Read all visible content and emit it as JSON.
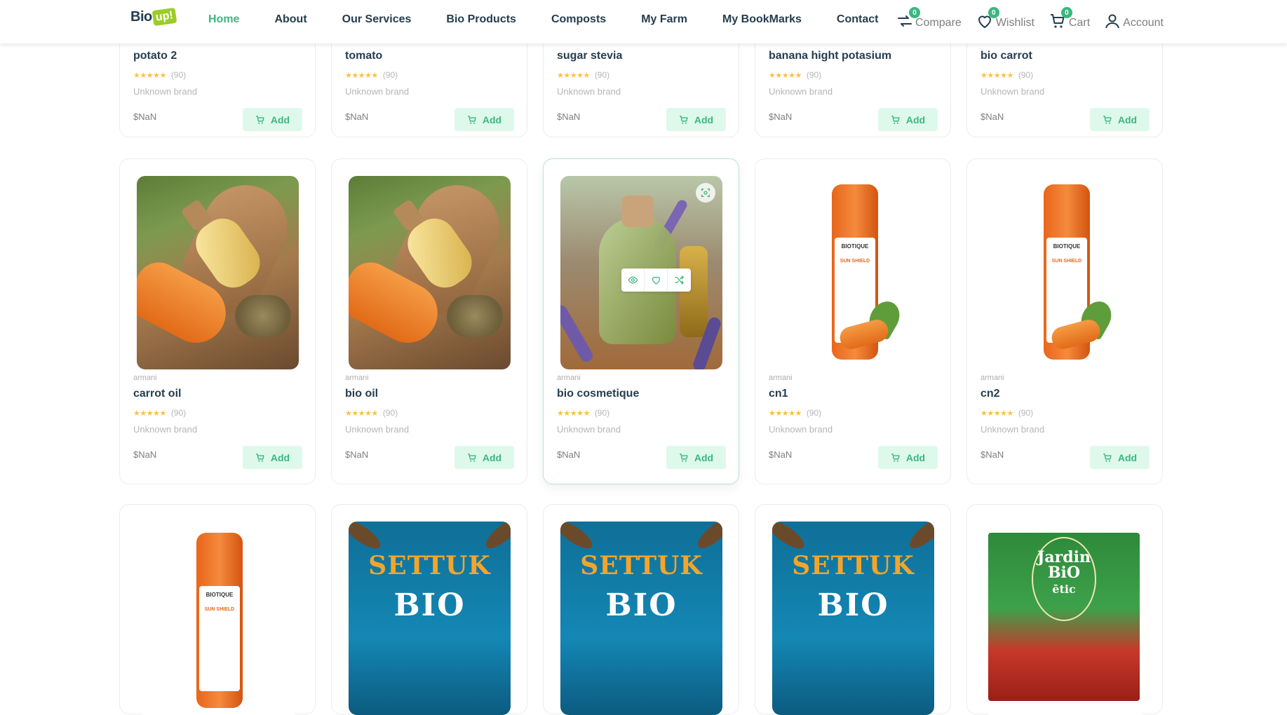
{
  "header": {
    "logo_text": "Bio",
    "logo_badge": "up!",
    "nav": [
      {
        "label": "Home",
        "active": true
      },
      {
        "label": "About"
      },
      {
        "label": "Our Services"
      },
      {
        "label": "Bio Products"
      },
      {
        "label": "Composts"
      },
      {
        "label": "My Farm"
      },
      {
        "label": "My BookMarks"
      },
      {
        "label": "Contact"
      }
    ],
    "actions": {
      "compare": {
        "label": "Compare",
        "count": "0"
      },
      "wishlist": {
        "label": "Wishlist",
        "count": "0"
      },
      "cart": {
        "label": "Cart",
        "count": "0"
      },
      "account": {
        "label": "Account"
      }
    }
  },
  "colors": {
    "accent": "#3bb77e",
    "text": "#253d4e",
    "star": "#fdc040",
    "button_bg": "#def9ec"
  },
  "rating_stars": "★★★★★",
  "add_label": "Add",
  "products_top": [
    {
      "name": "potato 2",
      "count": "(90)",
      "brand": "Unknown brand",
      "price": "$NaN"
    },
    {
      "name": "tomato",
      "count": "(90)",
      "brand": "Unknown brand",
      "price": "$NaN"
    },
    {
      "name": "sugar stevia",
      "count": "(90)",
      "brand": "Unknown brand",
      "price": "$NaN"
    },
    {
      "name": "banana hight potasium",
      "count": "(90)",
      "brand": "Unknown brand",
      "price": "$NaN"
    },
    {
      "name": "bio carrot",
      "count": "(90)",
      "brand": "Unknown brand",
      "price": "$NaN"
    }
  ],
  "products_mid": [
    {
      "vendor": "armani",
      "name": "carrot oil",
      "count": "(90)",
      "brand": "Unknown brand",
      "price": "$NaN",
      "image": "carrot-oil"
    },
    {
      "vendor": "armani",
      "name": "bio oil",
      "count": "(90)",
      "brand": "Unknown brand",
      "price": "$NaN",
      "image": "carrot-oil"
    },
    {
      "vendor": "armani",
      "name": "bio cosmetique",
      "count": "(90)",
      "brand": "Unknown brand",
      "price": "$NaN",
      "image": "lavender-oil"
    },
    {
      "vendor": "armani",
      "name": "cn1",
      "count": "(90)",
      "brand": "Unknown brand",
      "price": "$NaN",
      "image": "biotique-sunshield"
    },
    {
      "vendor": "armani",
      "name": "cn2",
      "count": "(90)",
      "brand": "Unknown brand",
      "price": "$NaN",
      "image": "biotique-sunshield"
    }
  ],
  "biotique_label": {
    "brand": "BIOTIQUE",
    "product": "SUN SHIELD"
  },
  "settuk_label": {
    "line1": "SETTUK",
    "line2": "BIO"
  },
  "jardin_label": {
    "line1": "Jardin",
    "line2": "BiO",
    "line3": "ētic"
  }
}
